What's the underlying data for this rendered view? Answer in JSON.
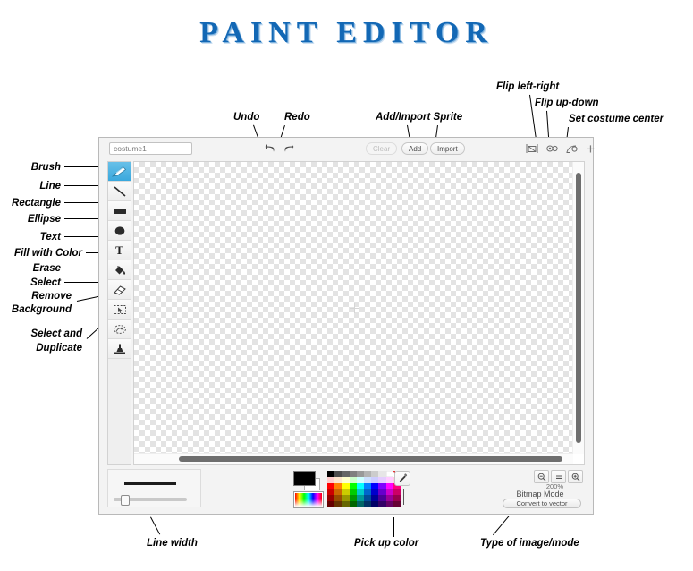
{
  "page": {
    "title": "PAINT EDITOR"
  },
  "editor": {
    "toolbar": {
      "costume_name_value": "costume1",
      "costume_name_placeholder": "costume1",
      "undo_label": "↶",
      "redo_label": "↷",
      "clear_label": "Clear",
      "add_label": "Add",
      "import_label": "Import",
      "plus_label": "+"
    },
    "tools": [
      {
        "name": "brush",
        "selected": true
      },
      {
        "name": "line",
        "selected": false
      },
      {
        "name": "rectangle",
        "selected": false
      },
      {
        "name": "ellipse",
        "selected": false
      },
      {
        "name": "text",
        "selected": false,
        "glyph": "T"
      },
      {
        "name": "fill-with-color",
        "selected": false
      },
      {
        "name": "erase",
        "selected": false
      },
      {
        "name": "select",
        "selected": false
      },
      {
        "name": "remove-background",
        "selected": false
      },
      {
        "name": "select-and-duplicate",
        "selected": false
      }
    ],
    "bottom": {
      "zoom_level": "200%",
      "mode_label": "Bitmap Mode",
      "convert_label": "Convert to vector",
      "zoom_out_label": "−",
      "zoom_reset_label": "=",
      "zoom_in_label": "+"
    },
    "palette": {
      "foreground_color": "#000000",
      "background_color": "#ffffff",
      "colors": [
        "#000000",
        "#4d4d4d",
        "#666666",
        "#808080",
        "#999999",
        "#b3b3b3",
        "#cccccc",
        "#e6e6e6",
        "#ffffff",
        "#ffffff",
        "#ffcccc",
        "#ffe5cc",
        "#ffffcc",
        "#ccffcc",
        "#ccffff",
        "#cce0ff",
        "#ccccff",
        "#e5ccff",
        "#ffccff",
        "#ffccdd",
        "#ff0000",
        "#ff8000",
        "#ffff00",
        "#00ff00",
        "#00ffff",
        "#0080ff",
        "#0000ff",
        "#8000ff",
        "#ff00ff",
        "#ff0080",
        "#cc0000",
        "#cc6600",
        "#cccc00",
        "#00cc00",
        "#00cccc",
        "#0066cc",
        "#0000cc",
        "#6600cc",
        "#cc00cc",
        "#cc0066",
        "#990000",
        "#994c00",
        "#999900",
        "#009900",
        "#009999",
        "#004c99",
        "#000099",
        "#4c0099",
        "#990099",
        "#99004c",
        "#660000",
        "#663300",
        "#666600",
        "#006600",
        "#006666",
        "#003366",
        "#000066",
        "#330066",
        "#660066",
        "#660033"
      ]
    }
  },
  "annotations": {
    "brush": "Brush",
    "line": "Line",
    "rectangle": "Rectangle",
    "ellipse": "Ellipse",
    "text": "Text",
    "fill_with_color": "Fill with Color",
    "erase": "Erase",
    "select": "Select",
    "remove_background_1": "Remove",
    "remove_background_2": "Background",
    "select_duplicate_1": "Select and",
    "select_duplicate_2": "Duplicate",
    "undo": "Undo",
    "redo": "Redo",
    "add_import_sprite": "Add/Import Sprite",
    "flip_left_right": "Flip left-right",
    "flip_up_down": "Flip up-down",
    "set_costume_center": "Set costume center",
    "line_width": "Line width",
    "pick_up_color": "Pick up color",
    "type_of_image_mode": "Type of image/mode"
  }
}
